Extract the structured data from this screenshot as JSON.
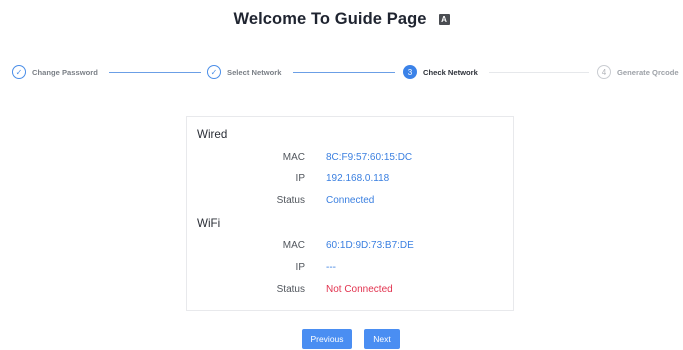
{
  "header": {
    "title": "Welcome To Guide Page",
    "translate_icon": "A"
  },
  "steps": [
    {
      "label": "Change Password",
      "state": "done",
      "marker": "✓"
    },
    {
      "label": "Select Network",
      "state": "done",
      "marker": "✓"
    },
    {
      "label": "Check Network",
      "state": "active",
      "marker": "3"
    },
    {
      "label": "Generate Qrcode",
      "state": "pending",
      "marker": "4"
    }
  ],
  "wired": {
    "title": "Wired",
    "mac_label": "MAC",
    "mac_value": "8C:F9:57:60:15:DC",
    "ip_label": "IP",
    "ip_value": "192.168.0.118",
    "status_label": "Status",
    "status_value": "Connected"
  },
  "wifi": {
    "title": "WiFi",
    "mac_label": "MAC",
    "mac_value": "60:1D:9D:73:B7:DE",
    "ip_label": "IP",
    "ip_value": "---",
    "status_label": "Status",
    "status_value": "Not Connected"
  },
  "buttons": {
    "previous": "Previous",
    "next": "Next"
  },
  "colors": {
    "accent": "#3b82e8",
    "value_text": "#3a7fe0",
    "error_text": "#e2334f"
  }
}
